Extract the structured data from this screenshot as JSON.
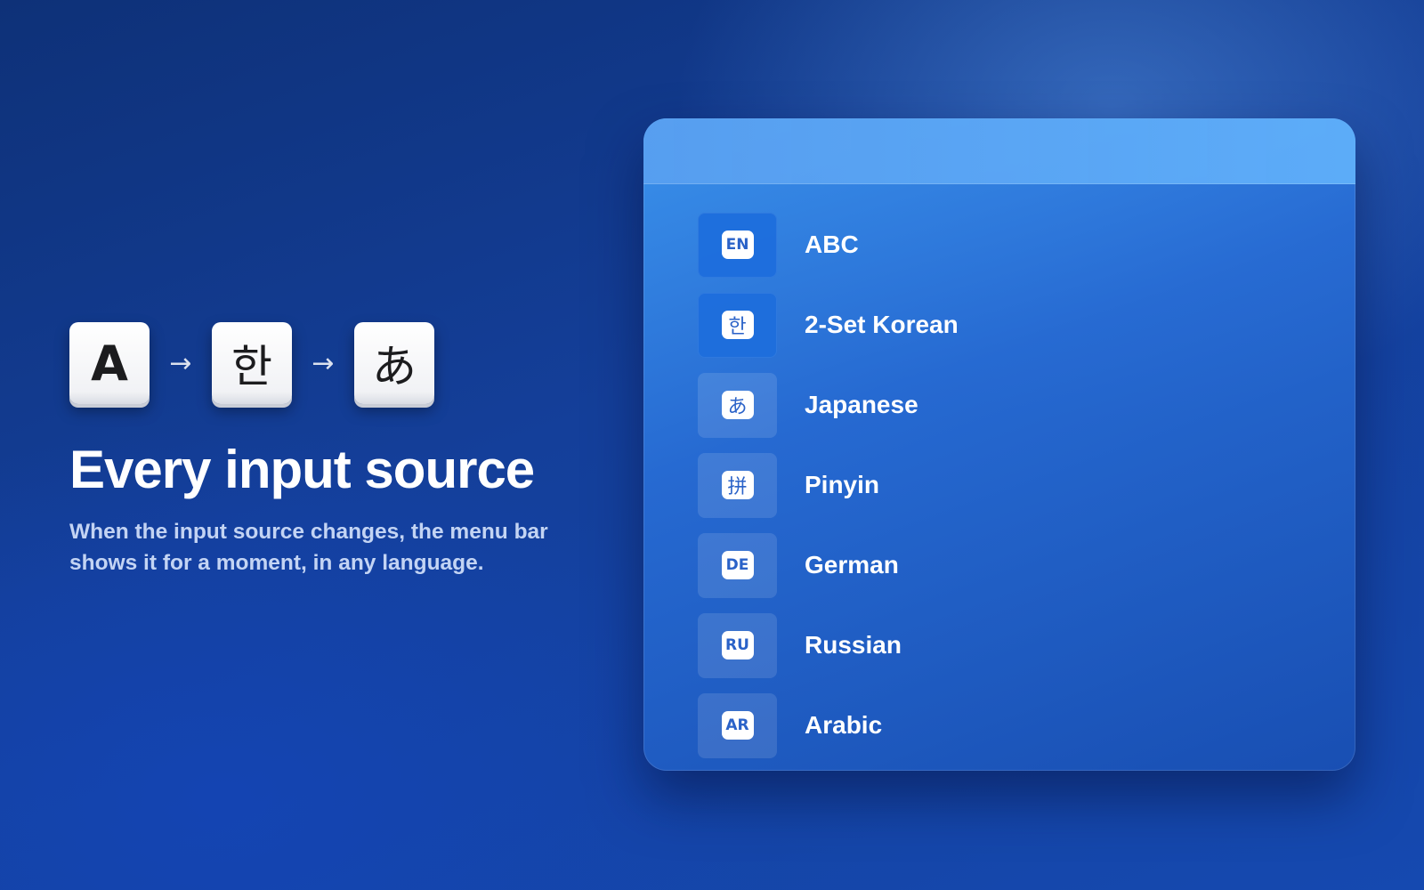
{
  "hero": {
    "keys": [
      "A",
      "한",
      "あ"
    ],
    "arrow": "→",
    "headline": "Every input source",
    "subline_1": "When the input source changes, the menu bar",
    "subline_2": "shows it for a moment, in any language."
  },
  "panel": {
    "items": [
      {
        "badge": "EN",
        "label": "ABC",
        "active": true,
        "icon": "en-badge-icon"
      },
      {
        "badge": "한",
        "label": "2-Set Korean",
        "active": true,
        "icon": "korean-badge-icon"
      },
      {
        "badge": "あ",
        "label": "Japanese",
        "active": false,
        "icon": "japanese-badge-icon"
      },
      {
        "badge": "拼",
        "label": "Pinyin",
        "active": false,
        "icon": "pinyin-badge-icon"
      },
      {
        "badge": "DE",
        "label": "German",
        "active": false,
        "icon": "de-badge-icon"
      },
      {
        "badge": "RU",
        "label": "Russian",
        "active": false,
        "icon": "ru-badge-icon"
      },
      {
        "badge": "AR",
        "label": "Arabic",
        "active": false,
        "icon": "ar-badge-icon"
      }
    ]
  },
  "colors": {
    "background": "#143f9a",
    "panel": "#3a8ee8",
    "badge_text": "#2a62c8",
    "text": "#ffffff"
  }
}
